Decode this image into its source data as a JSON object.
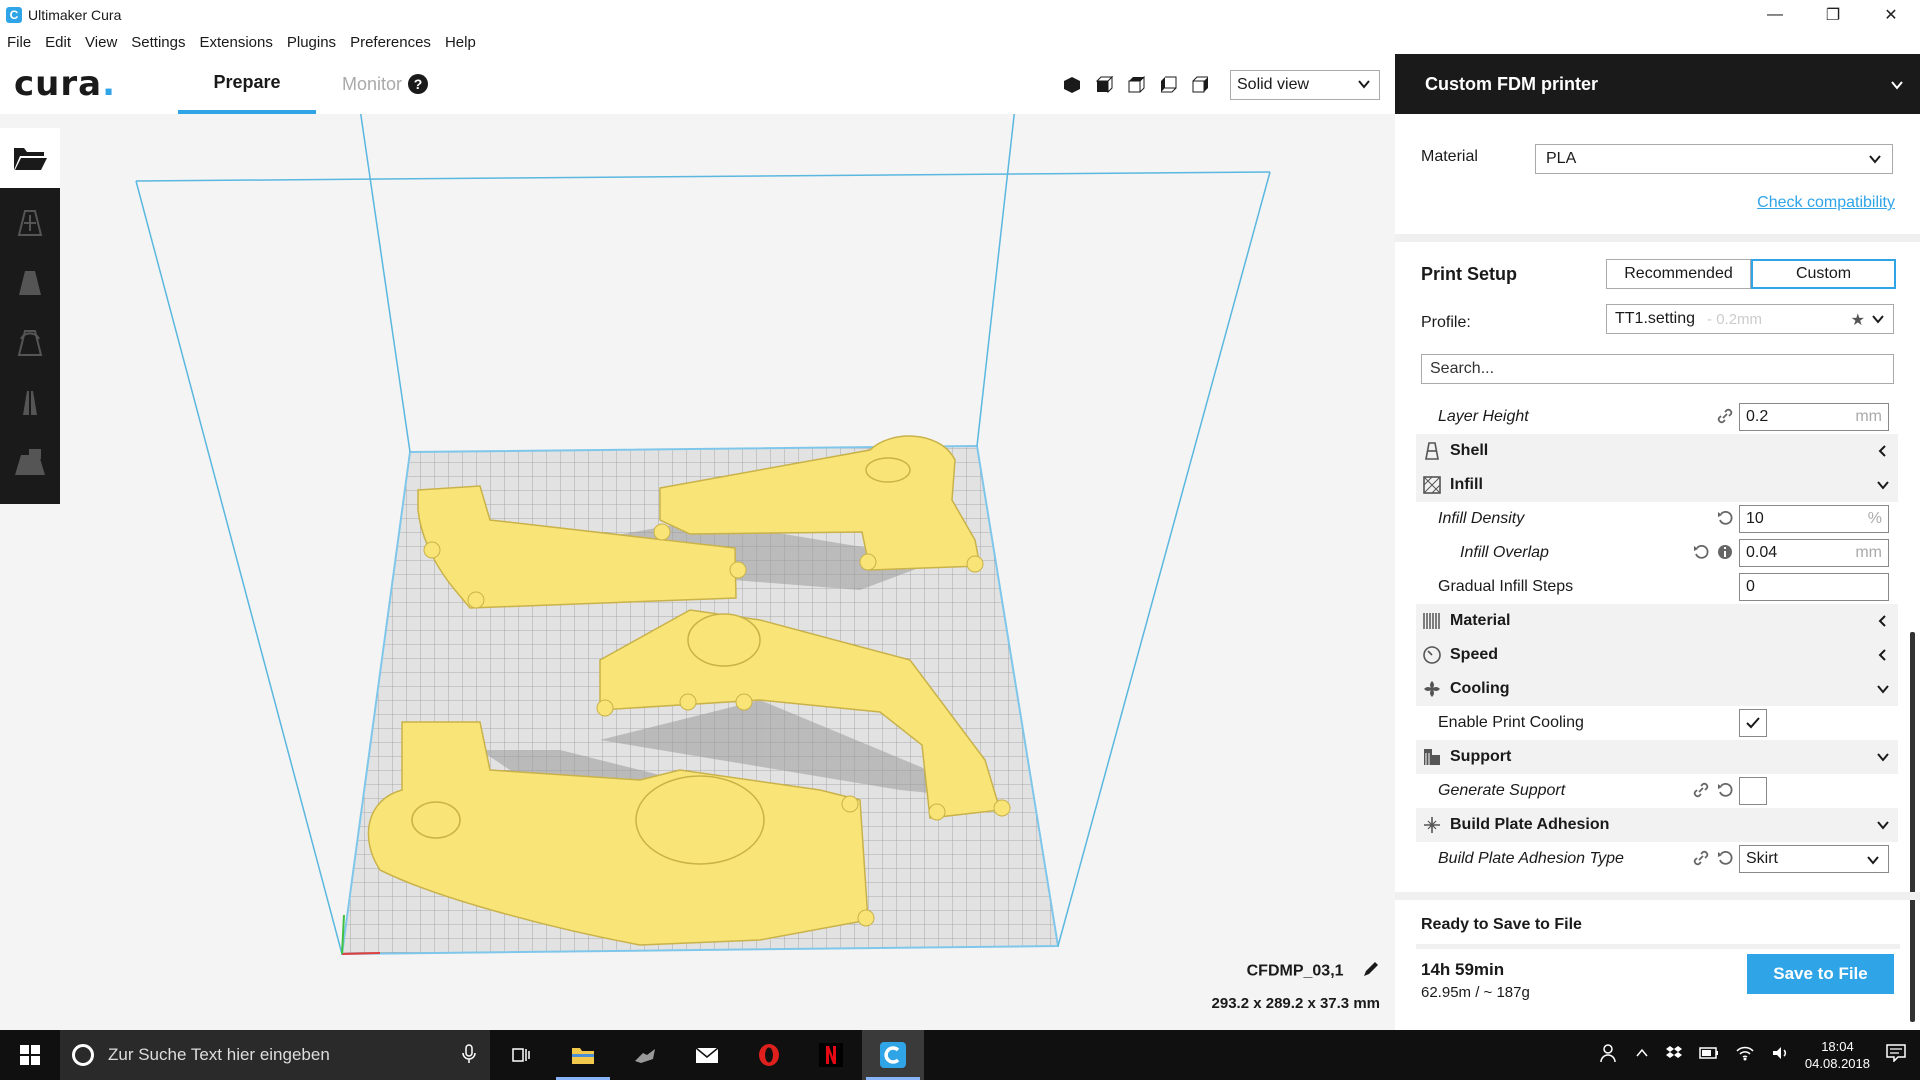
{
  "window": {
    "title": "Ultimaker Cura",
    "minimize": "—",
    "maximize": "❐",
    "close": "✕"
  },
  "menu": [
    "File",
    "Edit",
    "View",
    "Settings",
    "Extensions",
    "Plugins",
    "Preferences",
    "Help"
  ],
  "header": {
    "logo": "cura",
    "tabs": {
      "prepare": "Prepare",
      "monitor": "Monitor",
      "monitor_help": "?"
    },
    "view_mode": "Solid view"
  },
  "object": {
    "name": "CFDMP_03,1",
    "dimensions": "293.2 x 289.2 x 37.3 mm"
  },
  "printer": {
    "name": "Custom FDM printer"
  },
  "material": {
    "label": "Material",
    "value": "PLA",
    "check_compatibility": "Check compatibility"
  },
  "print_setup": {
    "title": "Print Setup",
    "tab_recommended": "Recommended",
    "tab_custom": "Custom",
    "profile_label": "Profile:",
    "profile_value": "TT1.setting",
    "profile_hint": "- 0.2mm",
    "search_placeholder": "Search..."
  },
  "settings": {
    "layer_height": {
      "label": "Layer Height",
      "value": "0.2",
      "unit": "mm"
    },
    "shell": "Shell",
    "infill": "Infill",
    "infill_density": {
      "label": "Infill Density",
      "value": "10",
      "unit": "%"
    },
    "infill_overlap": {
      "label": "Infill Overlap",
      "value": "0.04",
      "unit": "mm"
    },
    "gradual_infill": {
      "label": "Gradual Infill Steps",
      "value": "0"
    },
    "material": "Material",
    "speed": "Speed",
    "cooling": "Cooling",
    "enable_cooling": {
      "label": "Enable Print Cooling",
      "checked": true
    },
    "support": "Support",
    "generate_support": {
      "label": "Generate Support",
      "checked": false
    },
    "adhesion": "Build Plate Adhesion",
    "adhesion_type": {
      "label": "Build Plate Adhesion Type",
      "value": "Skirt"
    }
  },
  "output": {
    "status": "Ready to Save to File",
    "time": "14h 59min",
    "usage": "62.95m / ~ 187g",
    "save_button": "Save to File"
  },
  "taskbar": {
    "search_placeholder": "Zur Suche Text hier eingeben",
    "time": "18:04",
    "date": "04.08.2018"
  },
  "colors": {
    "accent": "#2fa4e7",
    "model": "#f9e577",
    "dark": "#1a1a1a",
    "plate": "#dcdcdc"
  }
}
